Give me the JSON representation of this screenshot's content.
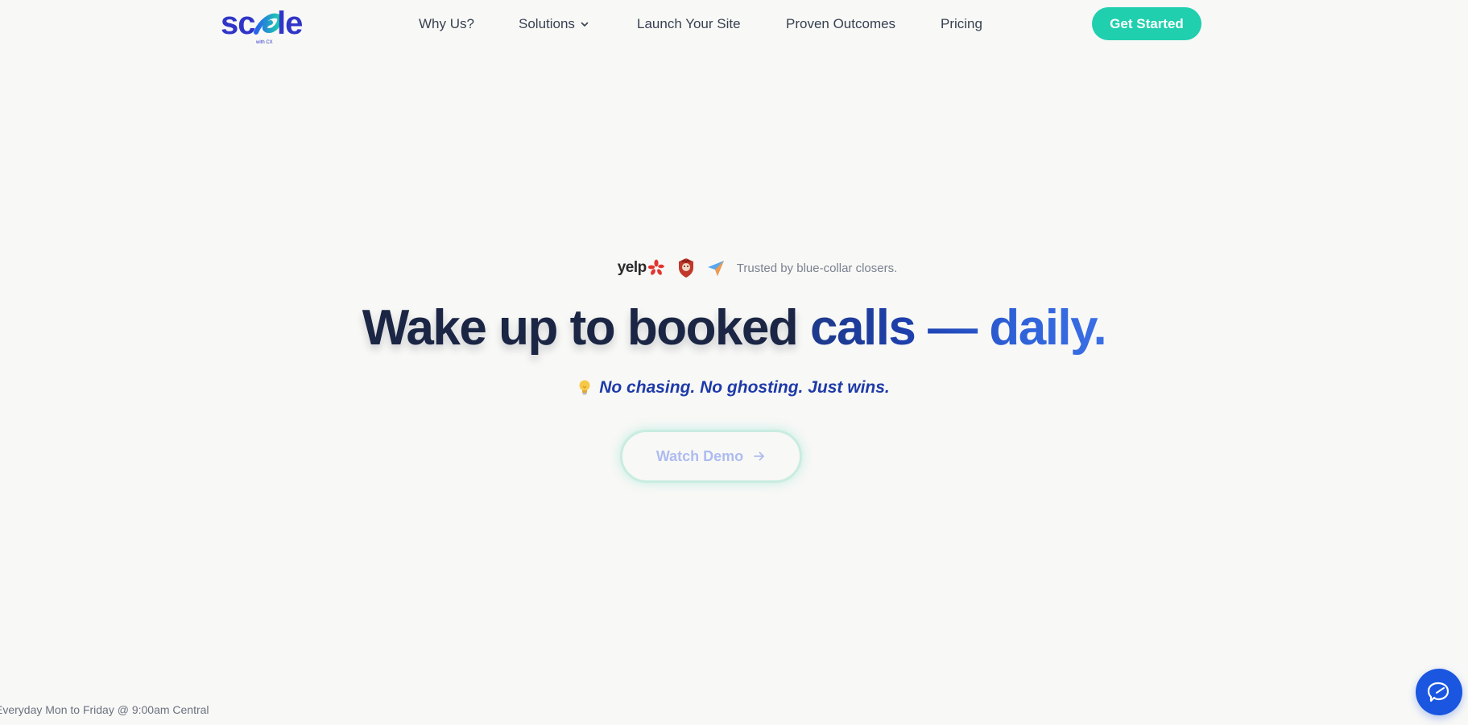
{
  "header": {
    "logo_text": "scale",
    "logo_subtext": "with CX",
    "nav": [
      {
        "label": "Why Us?"
      },
      {
        "label": "Solutions"
      },
      {
        "label": "Launch Your Site"
      },
      {
        "label": "Proven Outcomes"
      },
      {
        "label": "Pricing"
      }
    ],
    "cta_label": "Get Started"
  },
  "hero": {
    "trust": {
      "yelp_label": "yelp",
      "text": "Trusted by blue-collar closers."
    },
    "headline_part1": "Wake up to booked ",
    "headline_part2": "calls — daily.",
    "subheadline": "No chasing. No ghosting. Just wins.",
    "demo_label": "Watch Demo"
  },
  "footer": {
    "note": "Everyday Mon to Friday @ 9:00am Central"
  },
  "colors": {
    "accent": "#1fcfae",
    "brand_blue": "#1e40af",
    "chat_button": "#1a56e0"
  },
  "icons": [
    "scale-logo",
    "chevron-down-icon",
    "yelp-icon",
    "shield-icon",
    "paper-plane-icon",
    "lightbulb-icon",
    "arrow-right-icon",
    "chat-icon"
  ]
}
